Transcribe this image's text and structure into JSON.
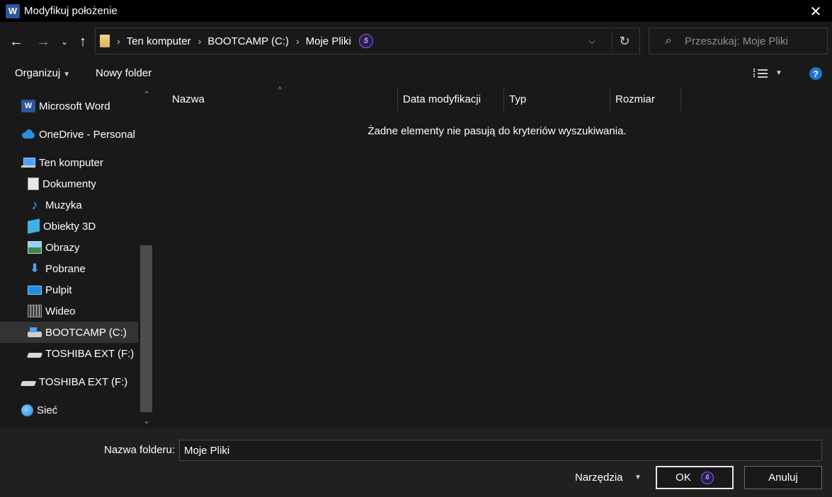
{
  "window": {
    "title": "Modyfikuj położenie",
    "app_icon_letter": "W"
  },
  "nav": {
    "breadcrumbs": [
      "Ten komputer",
      "BOOTCAMP (C:)",
      "Moje Pliki"
    ],
    "badge_number": "5",
    "search_placeholder": "Przeszukaj: Moje Pliki"
  },
  "toolbar": {
    "organize_label": "Organizuj",
    "new_folder_label": "Nowy folder",
    "help_label": "?"
  },
  "sidebar": {
    "items": [
      {
        "label": "Microsoft Word",
        "icon": "word-icon"
      },
      {
        "label": "OneDrive - Personal",
        "icon": "onedrive-icon"
      },
      {
        "label": "Ten komputer",
        "icon": "computer-icon"
      },
      {
        "label": "Dokumenty",
        "icon": "documents-icon"
      },
      {
        "label": "Muzyka",
        "icon": "music-icon"
      },
      {
        "label": "Obiekty 3D",
        "icon": "3d-objects-icon"
      },
      {
        "label": "Obrazy",
        "icon": "pictures-icon"
      },
      {
        "label": "Pobrane",
        "icon": "downloads-icon"
      },
      {
        "label": "Pulpit",
        "icon": "desktop-icon"
      },
      {
        "label": "Wideo",
        "icon": "videos-icon"
      },
      {
        "label": "BOOTCAMP (C:)",
        "icon": "drive-c-icon",
        "selected": true
      },
      {
        "label": "TOSHIBA EXT (F:)",
        "icon": "external-drive-icon"
      },
      {
        "label": "TOSHIBA EXT (F:)",
        "icon": "external-drive-icon"
      },
      {
        "label": "Sieć",
        "icon": "network-icon"
      }
    ]
  },
  "columns": {
    "name": "Nazwa",
    "date": "Data modyfikacji",
    "type": "Typ",
    "size": "Rozmiar"
  },
  "main": {
    "empty_message": "Żadne elementy nie pasują do kryteriów wyszukiwania."
  },
  "footer": {
    "folder_name_label": "Nazwa folderu:",
    "folder_name_value": "Moje Pliki",
    "tools_label": "Narzędzia",
    "ok_label": "OK",
    "ok_badge": "6",
    "cancel_label": "Anuluj"
  },
  "colors": {
    "background": "#191919",
    "titlebar": "#000000",
    "accent_badge": "#8a5cf5",
    "help_blue": "#1f74d1",
    "selected_row": "#333333"
  }
}
